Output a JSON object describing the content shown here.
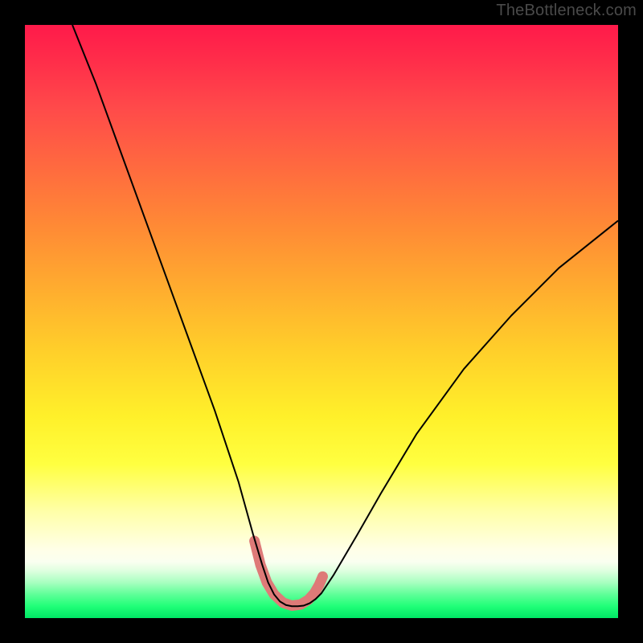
{
  "watermark": "TheBottleneck.com",
  "chart_data": {
    "type": "line",
    "title": "",
    "xlabel": "",
    "ylabel": "",
    "xlim": [
      0,
      100
    ],
    "ylim": [
      0,
      100
    ],
    "grid": false,
    "legend": false,
    "series": [
      {
        "name": "main-curve",
        "color": "#000000",
        "stroke_width": 2,
        "x": [
          8,
          12,
          16,
          20,
          24,
          28,
          32,
          36,
          38.5,
          40,
          41,
          42,
          43,
          44,
          45,
          46,
          47,
          48,
          49,
          50,
          52,
          56,
          60,
          66,
          74,
          82,
          90,
          100
        ],
        "y": [
          100,
          90,
          79,
          68,
          57,
          46,
          35,
          23,
          14,
          9,
          6,
          4,
          2.8,
          2.2,
          2,
          2,
          2.1,
          2.5,
          3.2,
          4.2,
          7.2,
          14,
          21,
          31,
          42,
          51,
          59,
          67
        ]
      },
      {
        "name": "trough-highlight",
        "color": "#de7a78",
        "stroke_width": 13,
        "linecap": "round",
        "x": [
          38.7,
          39.7,
          40.8,
          42.0,
          43.5,
          45.0,
          46.5,
          47.8,
          48.8,
          49.6,
          50.2
        ],
        "y": [
          13.0,
          9.0,
          6.0,
          4.0,
          2.6,
          2.1,
          2.3,
          3.1,
          4.2,
          5.6,
          7.0
        ]
      }
    ],
    "background_gradient": {
      "direction": "vertical",
      "stops": [
        {
          "pos": 0.0,
          "color": "#ff1a4a"
        },
        {
          "pos": 0.14,
          "color": "#ff4a4a"
        },
        {
          "pos": 0.34,
          "color": "#ff8a35"
        },
        {
          "pos": 0.55,
          "color": "#ffcf2a"
        },
        {
          "pos": 0.74,
          "color": "#ffff40"
        },
        {
          "pos": 0.89,
          "color": "#ffffe8"
        },
        {
          "pos": 0.94,
          "color": "#a8ffc0"
        },
        {
          "pos": 1.0,
          "color": "#00e765"
        }
      ]
    }
  }
}
